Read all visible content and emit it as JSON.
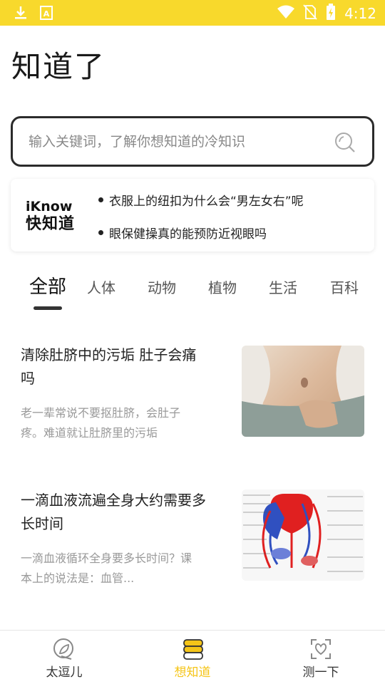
{
  "status_bar": {
    "time": "4:12",
    "icons": [
      "download-icon",
      "text-a-icon",
      "wifi-icon",
      "no-sim-icon",
      "battery-charging-icon"
    ]
  },
  "page": {
    "title": "知道了"
  },
  "search": {
    "placeholder": "输入关键词，了解你想知道的冷知识",
    "icon": "search-icon"
  },
  "banner": {
    "brand_en": "iKnow",
    "brand_cn": "快知道",
    "headlines": [
      "衣服上的纽扣为什么会“男左女右”呢",
      "眼保健操真的能预防近视眼吗"
    ]
  },
  "tabs": [
    {
      "label": "全部",
      "active": true
    },
    {
      "label": "人体"
    },
    {
      "label": "动物"
    },
    {
      "label": "植物"
    },
    {
      "label": "生活"
    },
    {
      "label": "百科"
    }
  ],
  "articles": [
    {
      "title": "清除肚脐中的污垢 肚子会痛吗",
      "summary": "老一辈常说不要抠肚脐，会肚子疼。难道就让肚脐里的污垢",
      "thumb": "belly-photo"
    },
    {
      "title": "一滴血液流遍全身大约需要多长时间",
      "summary": "一滴血液循环全身要多长时间？课本上的说法是：血管...",
      "thumb": "circulation-diagram"
    }
  ],
  "bottom_nav": [
    {
      "label": "太逗儿",
      "icon": "leaf-circle-icon",
      "active": false
    },
    {
      "label": "想知道",
      "icon": "stack-icon",
      "active": true
    },
    {
      "label": "测一下",
      "icon": "scan-heart-icon",
      "active": false
    }
  ],
  "colors": {
    "accent": "#f8d92c",
    "active_nav": "#f5c518",
    "artery": "#e02020",
    "vein": "#3050c0"
  }
}
